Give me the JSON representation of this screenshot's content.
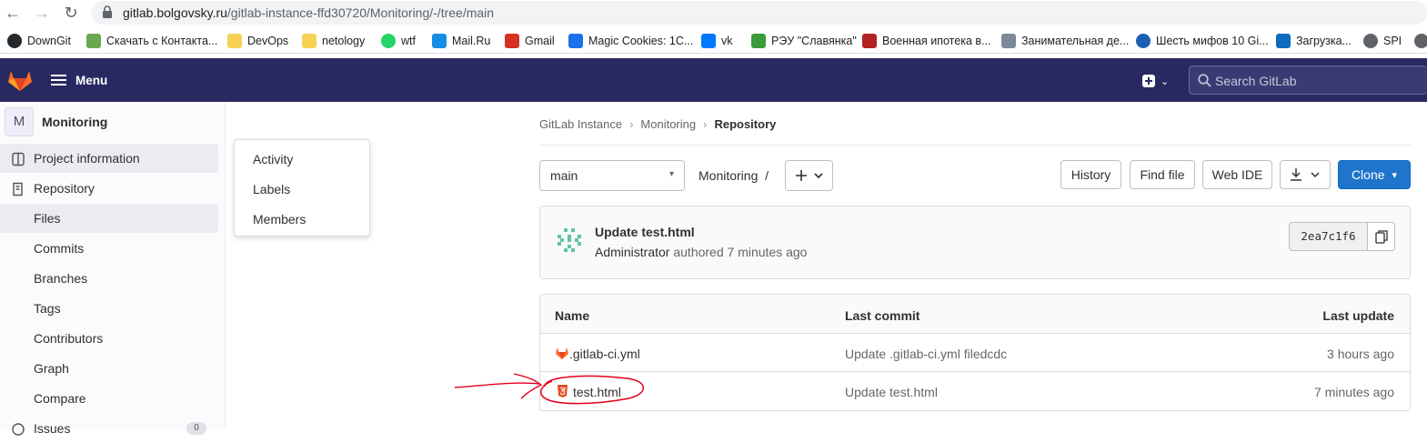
{
  "browser": {
    "url_host": "gitlab.bolgovsky.ru",
    "url_path": "/gitlab-instance-ffd30720/Monitoring/-/tree/main",
    "bookmarks": [
      {
        "label": "DownGit",
        "icon": "github-icon",
        "color": "#24292e"
      },
      {
        "label": "Скачать с Контакта...",
        "icon": "download-arrow-icon",
        "color": "#6aa84f"
      },
      {
        "label": "DevOps",
        "icon": "folder-icon",
        "color": "#f7d154"
      },
      {
        "label": "netology",
        "icon": "folder-icon",
        "color": "#f7d154"
      },
      {
        "label": "wtf",
        "icon": "whatsapp-icon",
        "color": "#25d366"
      },
      {
        "label": "Mail.Ru",
        "icon": "mailru-icon",
        "color": "#168de2"
      },
      {
        "label": "Gmail",
        "icon": "gmail-icon",
        "color": "#d93025"
      },
      {
        "label": "Magic Cookies: 1C...",
        "icon": "cookie-icon",
        "color": "#1a73e8"
      },
      {
        "label": "vk",
        "icon": "vk-icon",
        "color": "#0077ff"
      },
      {
        "label": "РЭУ \"Славянка\"",
        "icon": "tree-icon",
        "color": "#3a9b3a"
      },
      {
        "label": "Военная ипотека в...",
        "icon": "crown-icon",
        "color": "#b22222"
      },
      {
        "label": "Занимательная де...",
        "icon": "n-icon",
        "color": "#7a8a9a"
      },
      {
        "label": "Шесть мифов 10 Gi...",
        "icon": "globe-icon",
        "color": "#1a5fb4"
      },
      {
        "label": "Загрузка...",
        "icon": "outlook-icon",
        "color": "#0f6cbd"
      },
      {
        "label": "SPI",
        "icon": "globe-icon",
        "color": "#5f6368"
      }
    ]
  },
  "header": {
    "menu_label": "Menu",
    "search_placeholder": "Search GitLab"
  },
  "sidebar": {
    "project_initial": "M",
    "project_name": "Monitoring",
    "items": [
      {
        "label": "Project information",
        "icon": "project-info-icon"
      },
      {
        "label": "Repository",
        "icon": "repository-icon"
      },
      {
        "label": "Files"
      },
      {
        "label": "Commits"
      },
      {
        "label": "Branches"
      },
      {
        "label": "Tags"
      },
      {
        "label": "Contributors"
      },
      {
        "label": "Graph"
      },
      {
        "label": "Compare"
      },
      {
        "label": "Issues",
        "icon": "issues-icon",
        "badge": "0"
      }
    ]
  },
  "flyout": {
    "items": [
      "Activity",
      "Labels",
      "Members"
    ]
  },
  "breadcrumb": [
    "GitLab Instance",
    "Monitoring",
    "Repository"
  ],
  "toolbar": {
    "branch": "main",
    "repo_path": "Monitoring  /",
    "history": "History",
    "find_file": "Find file",
    "web_ide": "Web IDE",
    "clone": "Clone"
  },
  "commit": {
    "title": "Update test.html",
    "author": "Administrator",
    "rest": " authored 7 minutes ago",
    "sha": "2ea7c1f6"
  },
  "tree": {
    "headers": {
      "name": "Name",
      "last_commit": "Last commit",
      "last_update": "Last update"
    },
    "rows": [
      {
        "name": ".gitlab-ci.yml",
        "icon": "gitlab-icon",
        "last_commit": "Update .gitlab-ci.yml filedcdc",
        "last_update": "3 hours ago"
      },
      {
        "name": "test.html",
        "icon": "html5-icon",
        "last_commit": "Update test.html",
        "last_update": "7 minutes ago"
      }
    ]
  },
  "colors": {
    "header_bg": "#292961",
    "clone_blue": "#1f75cb",
    "annotation_red": "#e3001b"
  }
}
